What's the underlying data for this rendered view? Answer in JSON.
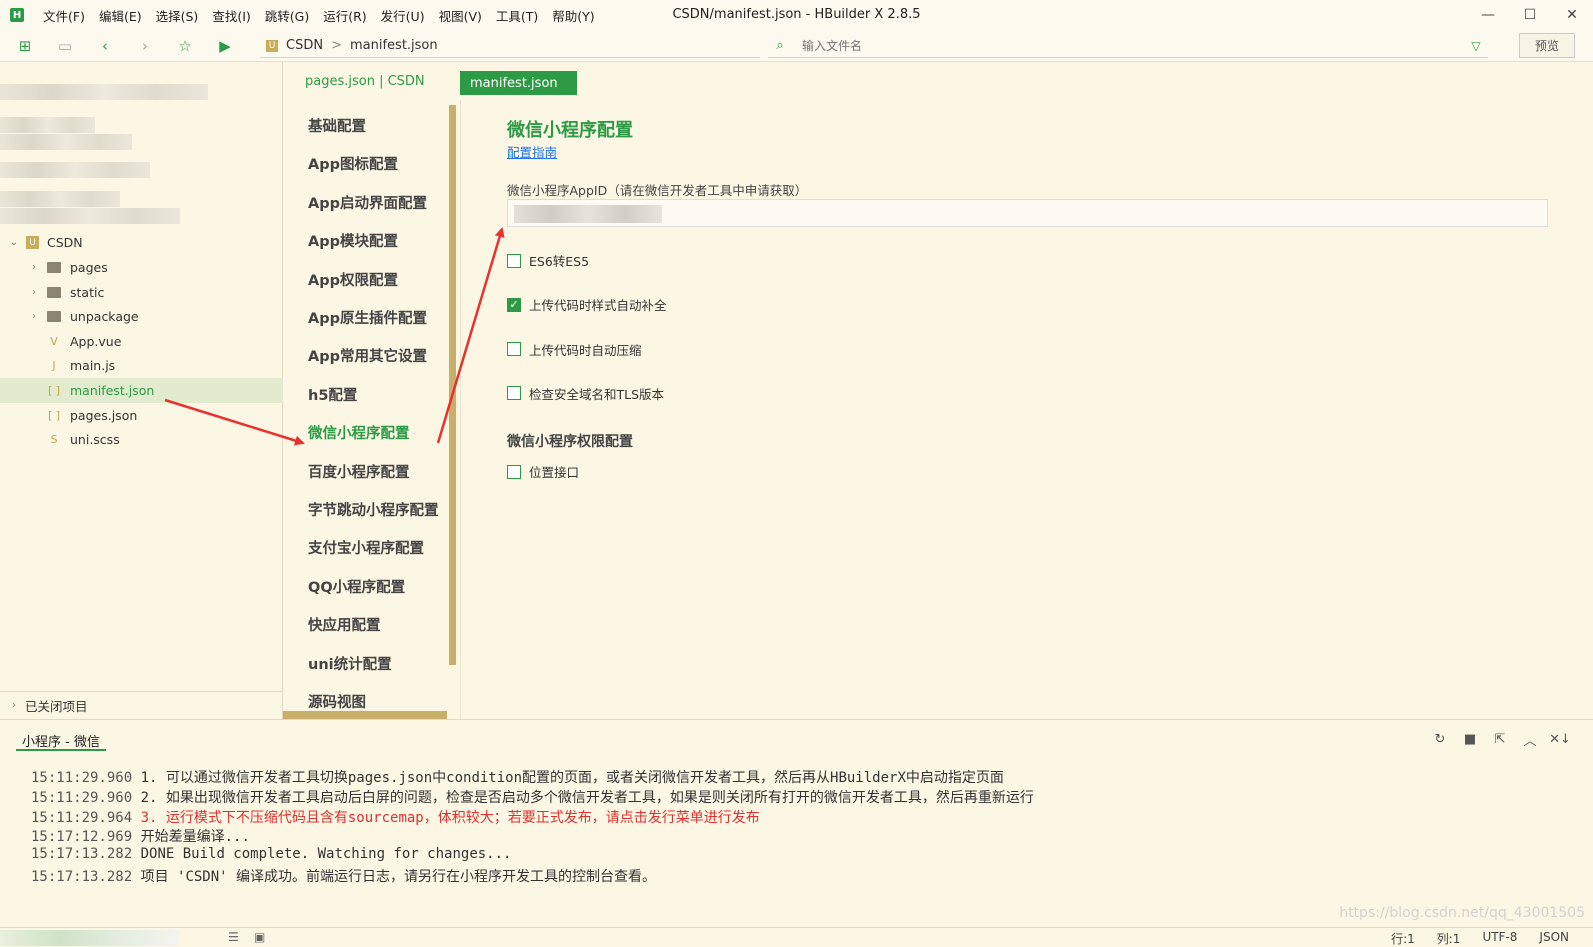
{
  "window": {
    "title": "CSDN/manifest.json - HBuilder X 2.8.5",
    "logo": "H",
    "minimize": "—",
    "maximize": "☐",
    "close": "✕"
  },
  "menu": [
    "文件(F)",
    "编辑(E)",
    "选择(S)",
    "查找(I)",
    "跳转(G)",
    "运行(R)",
    "发行(U)",
    "视图(V)",
    "工具(T)",
    "帮助(Y)"
  ],
  "breadcrumb": {
    "project_icon": "U",
    "project": "CSDN",
    "file": "manifest.json",
    "sep": ">"
  },
  "search": {
    "placeholder": "输入文件名"
  },
  "preview_label": "预览",
  "sidebar": {
    "project": {
      "name": "CSDN",
      "icon": "U"
    },
    "items": [
      {
        "label": "pages",
        "type": "folder"
      },
      {
        "label": "static",
        "type": "folder"
      },
      {
        "label": "unpackage",
        "type": "folder"
      },
      {
        "label": "App.vue",
        "type": "file",
        "icon": "V"
      },
      {
        "label": "main.js",
        "type": "file",
        "icon": "J"
      },
      {
        "label": "manifest.json",
        "type": "file",
        "icon": "[ ]",
        "selected": true
      },
      {
        "label": "pages.json",
        "type": "file",
        "icon": "[ ]"
      },
      {
        "label": "uni.scss",
        "type": "file",
        "icon": "S"
      }
    ],
    "closed_projects": "已关闭项目"
  },
  "tabs": {
    "pages": "pages.json | CSDN",
    "manifest": "manifest.json"
  },
  "config_nav": [
    "基础配置",
    "App图标配置",
    "App启动界面配置",
    "App模块配置",
    "App权限配置",
    "App原生插件配置",
    "App常用其它设置",
    "h5配置",
    "微信小程序配置",
    "百度小程序配置",
    "字节跳动小程序配置",
    "支付宝小程序配置",
    "QQ小程序配置",
    "快应用配置",
    "uni统计配置",
    "源码视图"
  ],
  "config_nav_active": "微信小程序配置",
  "panel": {
    "title": "微信小程序配置",
    "guide_link": "配置指南",
    "appid_label": "微信小程序AppID（请在微信开发者工具中申请获取）",
    "options": [
      {
        "label": "ES6转ES5",
        "checked": false
      },
      {
        "label": "上传代码时样式自动补全",
        "checked": true
      },
      {
        "label": "上传代码时自动压缩",
        "checked": false
      },
      {
        "label": "检查安全域名和TLS版本",
        "checked": false
      }
    ],
    "permission_title": "微信小程序权限配置",
    "permission_options": [
      {
        "label": "位置接口",
        "checked": false
      }
    ]
  },
  "console": {
    "tab": "小程序 - 微信",
    "tools": [
      "↻",
      "■",
      "⇱",
      "︿",
      "✕↓"
    ],
    "lines": [
      {
        "time": "15:11:29.960",
        "msg": "1. 可以通过微信开发者工具切换pages.json中condition配置的页面，或者关闭微信开发者工具，然后再从HBuilderX中启动指定页面",
        "error": false
      },
      {
        "time": "15:11:29.960",
        "msg": "2. 如果出现微信开发者工具启动后白屏的问题，检查是否启动多个微信开发者工具，如果是则关闭所有打开的微信开发者工具，然后再重新运行",
        "error": false
      },
      {
        "time": "15:11:29.964",
        "msg": "3. 运行模式下不压缩代码且含有sourcemap，体积较大；若要正式发布，请点击发行菜单进行发布",
        "error": true
      },
      {
        "time": "15:17:12.969",
        "msg": "开始差量编译...",
        "error": false
      },
      {
        "time": "15:17:13.282",
        "msg": " DONE  Build complete. Watching for changes...",
        "error": false
      },
      {
        "time": "15:17:13.282",
        "msg": "项目 'CSDN' 编译成功。前端运行日志，请另行在小程序开发工具的控制台查看。",
        "error": false
      }
    ]
  },
  "status": {
    "line": "行:1",
    "col": "列:1",
    "encoding": "UTF-8",
    "lang": "JSON"
  },
  "watermark": "https://blog.csdn.net/qq_43001505",
  "colors": {
    "accent": "#2d9b45",
    "annotation_arrow": "#e8322d",
    "link": "#1a73e8"
  }
}
